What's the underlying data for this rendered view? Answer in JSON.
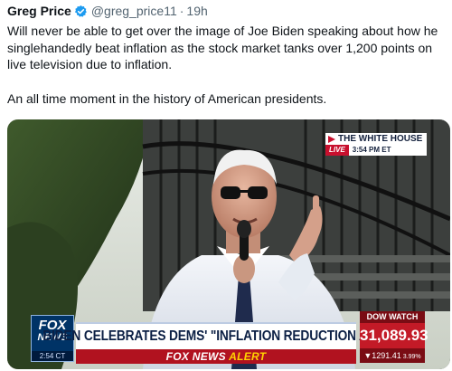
{
  "tweet": {
    "author_name": "Greg Price",
    "handle": "@greg_price11",
    "separator": "·",
    "time": "19h",
    "text_line_1": "Will never be able to get over the image of Joe Biden speaking about how he singlehandedly beat inflation as the stock market tanks over 1,200 points on live television due to inflation.",
    "text_line_2": "An all time moment in the history of American presidents.",
    "verified_color": "#1d9bf0"
  },
  "media": {
    "bug": {
      "location": "THE WHITE HOUSE",
      "live_label": "LIVE",
      "time": "3:54 PM ET"
    },
    "chyron": {
      "logo_top": "FOX",
      "logo_bottom": "NEWS",
      "logo_time": "2:54 CT",
      "headline": "BIDEN CELEBRATES DEMS' \"INFLATION REDUCTION ACT\"",
      "alert_prefix": "FOX NEWS ",
      "alert_word": "ALERT"
    },
    "ticker": {
      "label": "DOW WATCH",
      "value": "31,089.93",
      "change": "▼1291.41",
      "change_pct": "3.99%"
    },
    "colors": {
      "fox_blue": "#003366",
      "alert_red": "#b1121f",
      "dow_red": "#c31a27"
    }
  }
}
